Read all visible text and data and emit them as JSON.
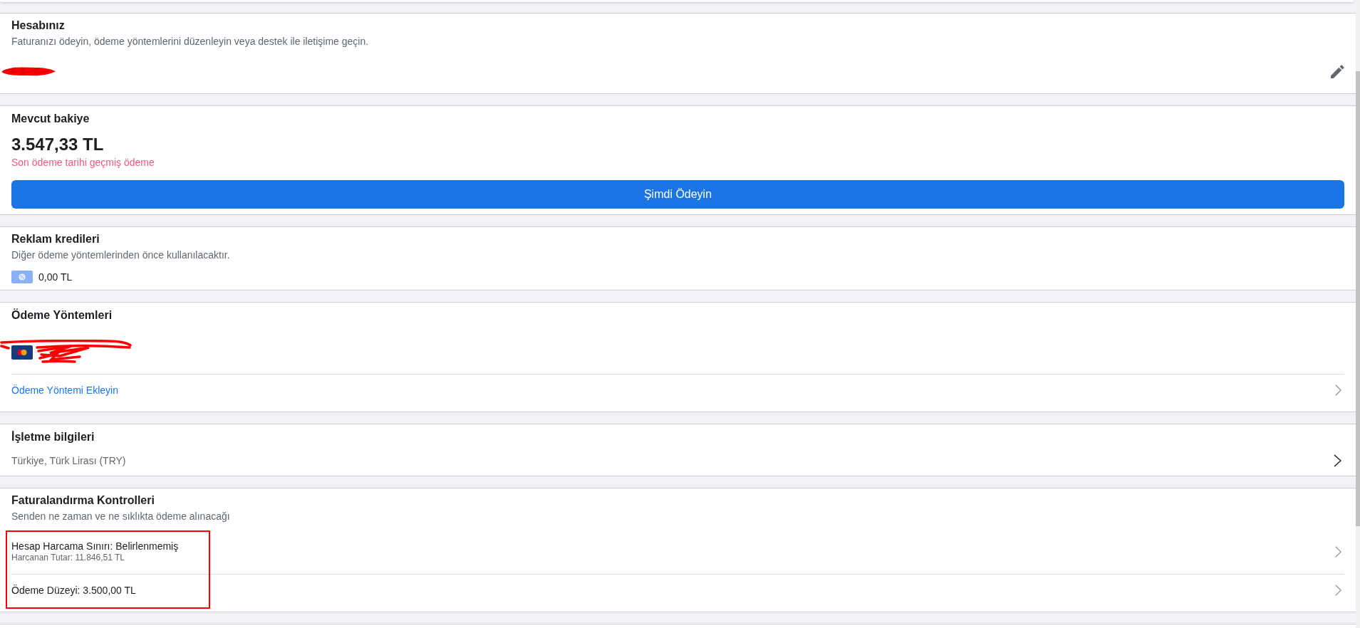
{
  "account": {
    "title": "Hesabınız",
    "subtitle": "Faturanızı ödeyin, ödeme yöntemlerini düzenleyin veya destek ile iletişime geçin.",
    "name_redacted": true
  },
  "balance": {
    "title": "Mevcut bakiye",
    "amount": "3.547,33 TL",
    "status": "Son ödeme tarihi geçmiş ödeme",
    "button": "Şimdi Ödeyin"
  },
  "ad_credits": {
    "title": "Reklam kredileri",
    "subtitle": "Diğer ödeme yöntemlerinden önce kullanılacaktır.",
    "amount": "0,00 TL"
  },
  "payment_methods": {
    "title": "Ödeme Yöntemleri",
    "cards": [
      {
        "redacted": true
      }
    ],
    "add_link": "Ödeme Yöntemi Ekleyin"
  },
  "business_info": {
    "title": "İşletme bilgileri",
    "value": "Türkiye, Türk Lirası (TRY)"
  },
  "billing_controls": {
    "title": "Faturalandırma Kontrolleri",
    "subtitle": "Senden ne zaman ve ne sıklıkta ödeme alınacağı",
    "highlighted": true,
    "rows": [
      {
        "label": "Hesap Harcama Sınırı: Belirlenmemiş",
        "detail": "Harcanan Tutar: 11.846,51 TL"
      },
      {
        "label": "Ödeme Düzeyi: 3.500,00 TL"
      }
    ]
  }
}
